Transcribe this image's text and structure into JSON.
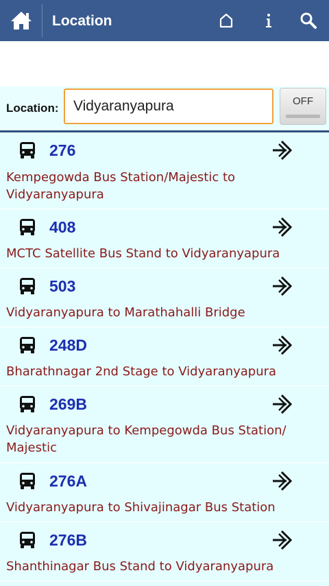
{
  "header": {
    "title": "Location",
    "icons": [
      "home-icon",
      "house-outline-icon",
      "info-icon",
      "search-icon"
    ],
    "background": "#3a5b8f"
  },
  "location_bar": {
    "label": "Location:",
    "value": "Vidyaranyapura",
    "toggle_label": "OFF",
    "input_border_color": "#f0a23a"
  },
  "routes": [
    {
      "number": "276",
      "description": "Kempegowda Bus Station/Majestic to Vidyaranyapura"
    },
    {
      "number": "408",
      "description": "MCTC Satellite Bus Stand to Vidyaranyapura"
    },
    {
      "number": "503",
      "description": "Vidyaranyapura to Marathahalli Bridge"
    },
    {
      "number": "248D",
      "description": "Bharathnagar 2nd Stage to Vidyaranyapura"
    },
    {
      "number": "269B",
      "description": "Vidyaranyapura to Kempegowda Bus Station/ Majestic"
    },
    {
      "number": "276A",
      "description": "Vidyaranyapura to Shivajinagar Bus Station"
    },
    {
      "number": "276B",
      "description": "Shanthinagar Bus Stand to Vidyaranyapura"
    }
  ],
  "colors": {
    "route_number": "#1b2fb0",
    "route_description": "#8b1a1a",
    "list_background": "#e4fdff"
  }
}
